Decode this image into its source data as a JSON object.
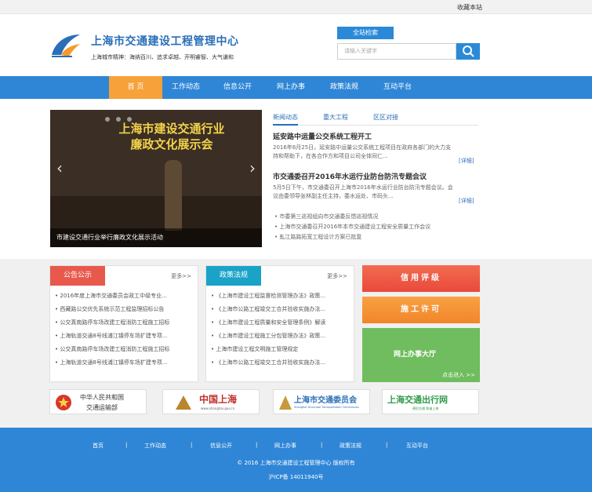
{
  "topbar": {
    "favorite": "收藏本站"
  },
  "header": {
    "site_name": "上海市交通建设工程管理中心",
    "motto": "上海城市精神：海纳百川、追求卓越、开明睿智、大气谦和",
    "search_tab": "全站检索",
    "search_placeholder": "请输入关键字"
  },
  "nav": {
    "items": [
      "首  页",
      "工作动态",
      "信息公开",
      "网上办事",
      "政策法规",
      "互动平台"
    ]
  },
  "slider": {
    "banner_line1": "上海市建设交通行业",
    "banner_line2": "廉政文化展示会",
    "caption": "市建设交通行业举行廉政文化展示活动"
  },
  "news": {
    "tabs": [
      "新闻动态",
      "重大工程",
      "区区对接"
    ],
    "item1_title": "延安路中运量公交系统工程开工",
    "item1_body": "2016年6月25日，延安路中运量公交系统工程项目在政府各部门的大力支持和帮助下，在各合作方和项目公司全体同仁...",
    "item2_title": "市交通委召开2016年水运行业防台防汛专题会议",
    "item2_body": "5月5日下午，市交通委召开上海市2016年水运行业防台防汛专题会议。会议由委领导张林副主任主持，委水运处、市码头...",
    "detail": "[详细]",
    "bullets": [
      "市委第三巡视组向市交通委反馈巡视情况",
      "上海市交通委召开2016年本市交通建设工程安全质量工作会议",
      "虬江路路拓宽工程设计方案已批复"
    ]
  },
  "panel_notice": {
    "title": "公告公示",
    "more": "更多>>",
    "items": [
      "2016年度上海市交通委员会政工中级专业...",
      "西藏路公交优先系统示范工程监理招标公告",
      "公交真南路停车场改建工程消防工程施工招标",
      "上海轨道交通8号线浦江镇停车场扩建专项...",
      "公交真南路停车场改建工程消防工程施工招标",
      "上海轨道交通8号线浦江镇停车场扩建专项..."
    ]
  },
  "panel_policy": {
    "title": "政策法规",
    "more": "更多>>",
    "items": [
      "《上海市建设工程监督检测管理办法》政策...",
      "《上海市公路工程竣交工合并验收实施办法...",
      "《上海市建设工程质量和安全管理条例》解读",
      "《上海市建设工程施工分包管理办法》政策...",
      "上海市建设工程文明施工管理规定",
      "《上海市公路工程竣交工合并验收实施办法..."
    ]
  },
  "right_tiles": {
    "credit": "信用评级",
    "permit": "施工许可",
    "hall": "网上办事大厅",
    "enter": "点击进入 >>"
  },
  "links": {
    "mot_line1": "中华人民共和国",
    "mot_line2": "交通运输部",
    "china_sh": "中国上海",
    "china_sh_url": "www.shanghai.gov.cn",
    "jtw": "上海市交通委员会",
    "jtw_en": "Shanghai Municipal Transportation Commission",
    "travel": "上海交通出行网",
    "travel_sub": "便民交通  和谐上海"
  },
  "footer": {
    "links": [
      "首页",
      "工作动态",
      "信息公开",
      "网上办事",
      "政策法规",
      "互动平台"
    ],
    "sep": "|",
    "copyright": "© 2016 上海市交通建设工程管理中心  版权所有",
    "icp": "沪ICP备 14011940号"
  },
  "colors": {
    "brand_blue": "#2f86d6",
    "nav_active": "#f7a13a",
    "notice_red": "#e8594c",
    "policy_teal": "#1ba3c7",
    "credit_red": "#ef5a4a",
    "permit_orange": "#f5912e",
    "hall_green": "#6fbd5e"
  }
}
